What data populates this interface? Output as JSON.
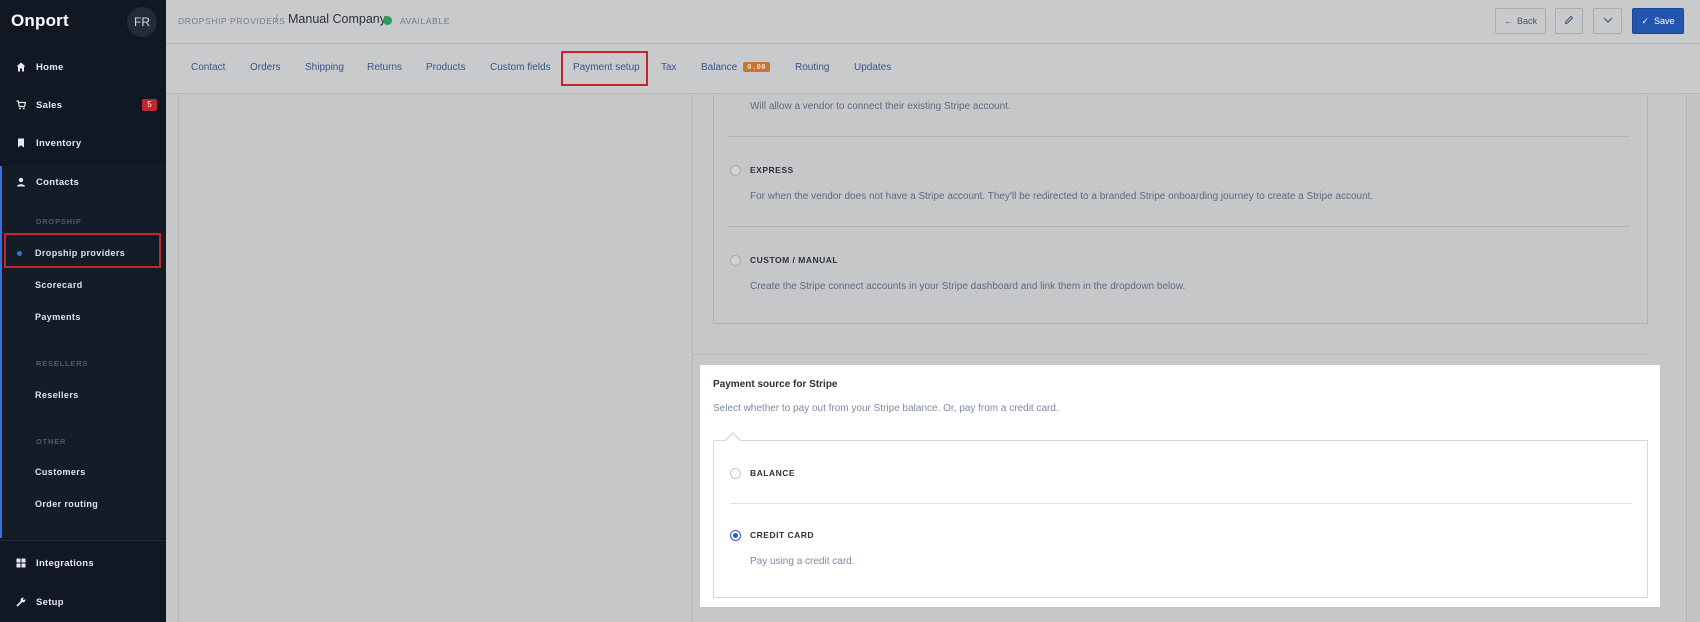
{
  "app": {
    "logo": "Onport",
    "avatar_initials": "FR"
  },
  "sidebar": {
    "items": [
      {
        "label": "Home",
        "icon": "home-icon"
      },
      {
        "label": "Sales",
        "icon": "cart-icon",
        "badge": "5"
      },
      {
        "label": "Inventory",
        "icon": "bookmark-icon"
      },
      {
        "label": "Contacts",
        "icon": "user-icon"
      },
      {
        "label": "Integrations",
        "icon": "grid-icon"
      },
      {
        "label": "Setup",
        "icon": "wrench-icon"
      }
    ],
    "sections": [
      {
        "heading": "DROPSHIP",
        "items": [
          "Dropship providers",
          "Scorecard",
          "Payments"
        ]
      },
      {
        "heading": "RESELLERS",
        "items": [
          "Resellers"
        ]
      },
      {
        "heading": "OTHER",
        "items": [
          "Customers",
          "Order routing"
        ]
      }
    ],
    "active_item": "Dropship providers"
  },
  "header": {
    "breadcrumb": "DROPSHIP PROVIDERS",
    "breadcrumb_sep": "/",
    "title": "Manual Company",
    "status": "AVAILABLE",
    "status_color": "#2f9c58",
    "back_label": "Back",
    "save_label": "Save"
  },
  "tabs": {
    "items": [
      "Contact",
      "Orders",
      "Shipping",
      "Returns",
      "Products",
      "Custom fields",
      "Payment setup",
      "Tax",
      "Balance",
      "Routing",
      "Updates"
    ],
    "active": "Payment setup",
    "balance_badge": "0.00"
  },
  "stripe_account": {
    "standard_desc": "Will allow a vendor to connect their existing Stripe account.",
    "options": [
      {
        "title": "EXPRESS",
        "desc": "For when the vendor does not have a Stripe account. They'll be redirected to a branded Stripe onboarding journey to create a Stripe account."
      },
      {
        "title": "CUSTOM / MANUAL",
        "desc": "Create the Stripe connect accounts in your Stripe dashboard and link them in the dropdown below."
      }
    ]
  },
  "payment_source": {
    "title": "Payment source for Stripe",
    "subtitle": "Select whether to pay out from your Stripe balance. Or, pay from a credit card.",
    "options": [
      {
        "title": "BALANCE",
        "desc": "",
        "selected": false
      },
      {
        "title": "CREDIT CARD",
        "desc": "Pay using a credit card.",
        "selected": true
      }
    ]
  },
  "colors": {
    "accent": "#2155b0",
    "highlight": "#c1272d",
    "sidebar_bg": "#111823"
  }
}
